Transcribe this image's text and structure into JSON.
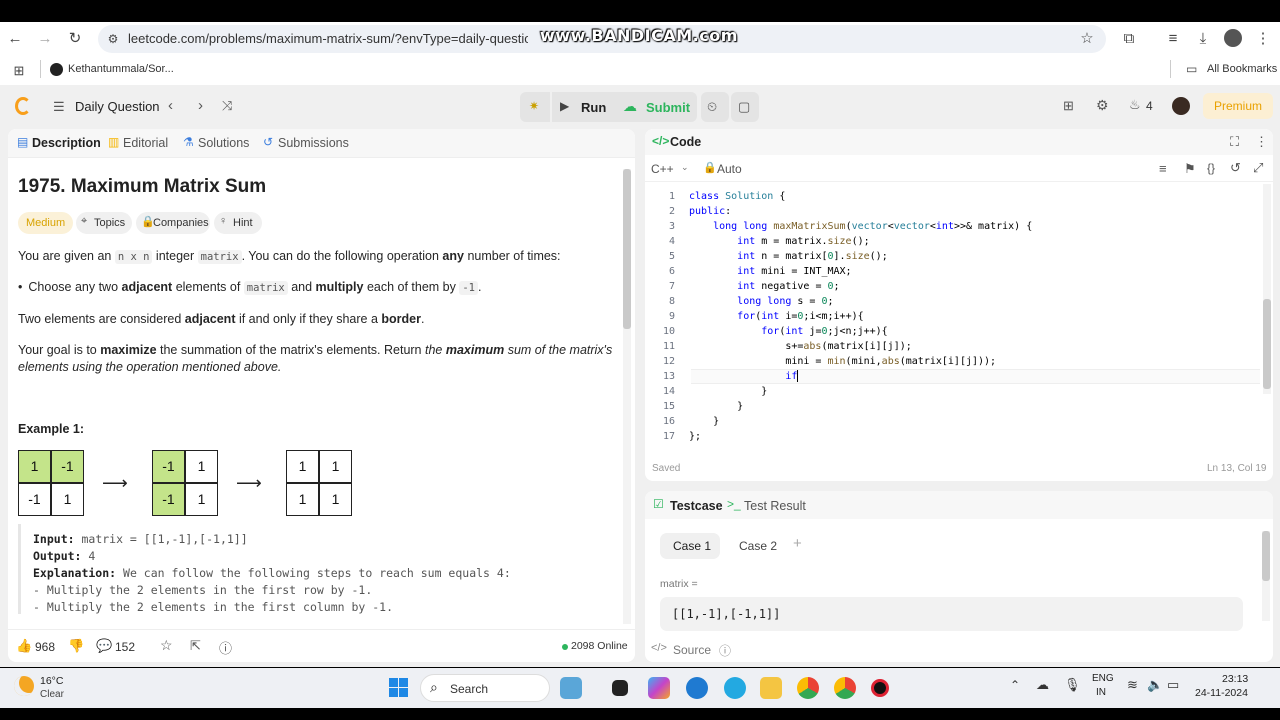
{
  "browser": {
    "url": "leetcode.com/problems/maximum-matrix-sum/?envType=daily-question&envId=2024-11-24",
    "watermark": "www.BANDICAM.com",
    "bookmark": "Kethantummala/Sor...",
    "all_bookmarks": "All Bookmarks"
  },
  "header": {
    "daily_question": "Daily Question",
    "run": "Run",
    "submit": "Submit",
    "streak": "4",
    "premium": "Premium"
  },
  "left": {
    "tabs": [
      "Description",
      "Editorial",
      "Solutions",
      "Submissions"
    ],
    "title": "1975. Maximum Matrix Sum",
    "difficulty": "Medium",
    "chips": [
      "Topics",
      "Companies",
      "Hint"
    ],
    "p1_a": "You are given an ",
    "p1_code1": "n x n",
    "p1_b": " integer ",
    "p1_code2": "matrix",
    "p1_c": ". You can do the following operation ",
    "p1_bold": "any",
    "p1_d": " number of times:",
    "li_a": "Choose any two ",
    "li_bold1": "adjacent",
    "li_b": " elements of ",
    "li_code": "matrix",
    "li_c": " and ",
    "li_bold2": "multiply",
    "li_d": " each of them by ",
    "li_code2": "-1",
    "li_e": ".",
    "p2_a": "Two elements are considered ",
    "p2_bold1": "adjacent",
    "p2_b": " if and only if they share a ",
    "p2_bold2": "border",
    "p2_c": ".",
    "p3_a": "Your goal is to ",
    "p3_bold": "maximize",
    "p3_b": " the summation of the matrix's elements. Return ",
    "p3_i1": "the ",
    "p3_ib": "maximum",
    "p3_i2": " sum of the matrix's",
    "p3_line2": "elements using the operation mentioned above.",
    "example_title": "Example 1:",
    "grids": [
      [
        "1",
        "-1",
        "-1",
        "1"
      ],
      [
        "-1",
        "1",
        "-1",
        "1"
      ],
      [
        "1",
        "1",
        "1",
        "1"
      ]
    ],
    "input_label": "Input:",
    "input_val": " matrix = [[1,-1],[-1,1]]",
    "output_label": "Output:",
    "output_val": " 4",
    "explanation_label": "Explanation:",
    "explanation_val": " We can follow the following steps to reach sum equals 4:",
    "step1": "- Multiply the 2 elements in the first row by -1.",
    "step2": "- Multiply the 2 elements in the first column by -1.",
    "likes": "968",
    "comments": "152",
    "online": "2098 Online"
  },
  "code": {
    "title": "Code",
    "lang": "C++",
    "mode": "Auto",
    "lines": [
      "class Solution {",
      "public:",
      "    long long maxMatrixSum(vector<vector<int>>& matrix) {",
      "        int m = matrix.size();",
      "        int n = matrix[0].size();",
      "        int mini = INT_MAX;",
      "        int negative = 0;",
      "        long long s = 0;",
      "        for(int i=0;i<m;i++){",
      "            for(int j=0;j<n;j++){",
      "                s+=abs(matrix[i][j]);",
      "                mini = min(mini,abs(matrix[i][j]));",
      "                if",
      "            }",
      "        }",
      "    }",
      "};"
    ],
    "saved": "Saved",
    "cursor": "Ln 13, Col 19"
  },
  "testcase": {
    "tab1": "Testcase",
    "tab2": "Test Result",
    "case1": "Case 1",
    "case2": "Case 2",
    "var_label": "matrix =",
    "var_value": "[[1,-1],[-1,1]]",
    "source": "Source"
  },
  "taskbar": {
    "temp": "16°C",
    "weather": "Clear",
    "search": "Search",
    "lang1": "ENG",
    "lang2": "IN",
    "time": "23:13",
    "date": "24-11-2024"
  }
}
